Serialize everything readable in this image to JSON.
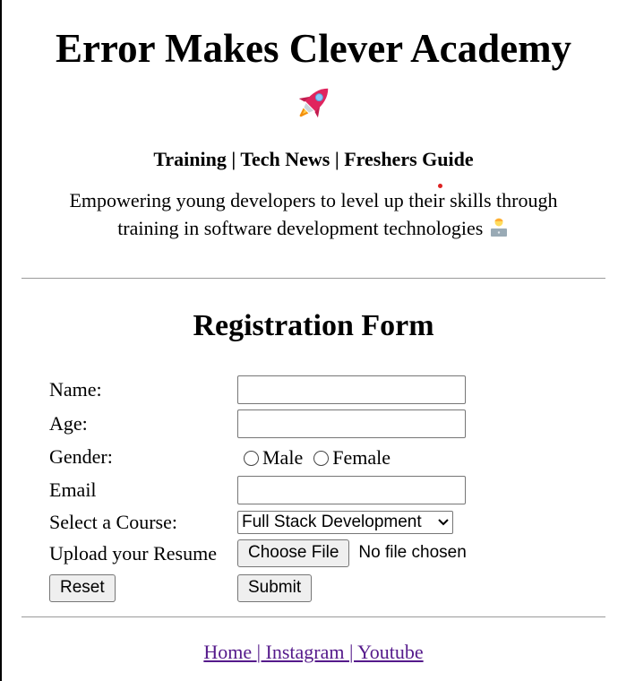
{
  "header": {
    "title": "Error Makes Clever Academy",
    "nav": "Training | Tech News | Freshers Guide",
    "tagline_line1": "Empowering young developers to level up their skills through",
    "tagline_line2": "training in software development technologies"
  },
  "form": {
    "title": "Registration Form",
    "name_label": "Name:",
    "age_label": "Age:",
    "gender_label": "Gender:",
    "gender_options": [
      "Male",
      "Female"
    ],
    "email_label": "Email",
    "course_label": "Select a Course:",
    "course_selected": "Full Stack Development",
    "resume_label": "Upload your Resume",
    "choose_file_label": "Choose File",
    "file_status": "No file chosen",
    "reset_label": "Reset",
    "submit_label": "Submit"
  },
  "footer": {
    "links": [
      "Home ",
      "| Instagram ",
      "| Youtube"
    ]
  },
  "icons": {
    "rocket": "rocket-icon",
    "developer": "developer-icon"
  }
}
